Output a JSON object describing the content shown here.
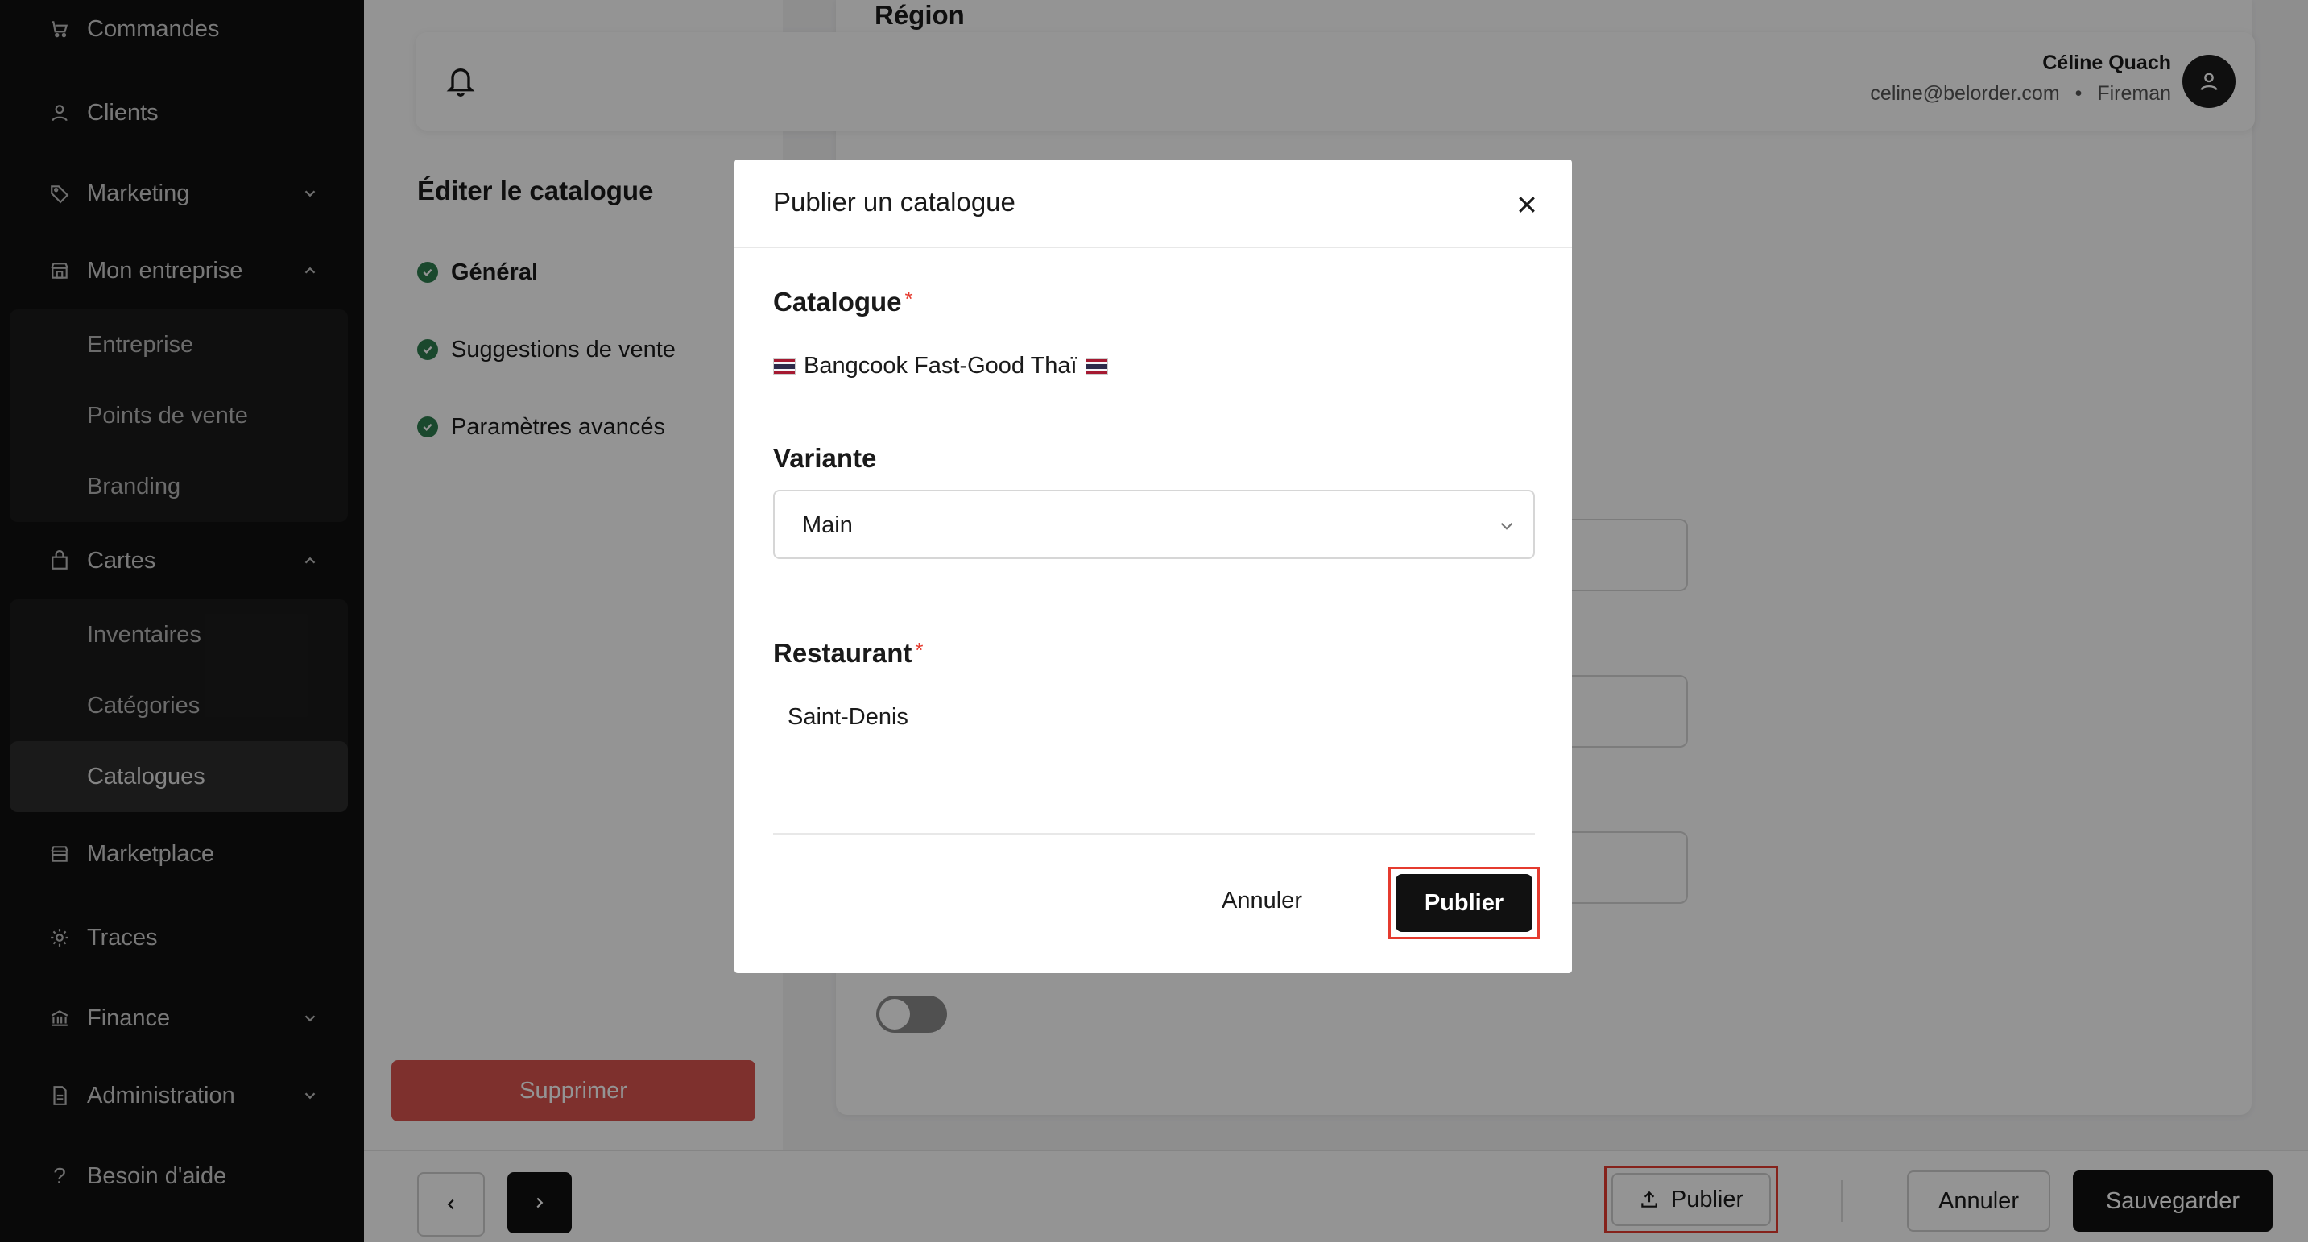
{
  "sidebar": {
    "items": [
      {
        "label": "Commandes",
        "icon": "cart-icon"
      },
      {
        "label": "Clients",
        "icon": "user-icon"
      },
      {
        "label": "Marketing",
        "icon": "tag-icon"
      },
      {
        "label": "Mon entreprise",
        "icon": "store-icon"
      },
      {
        "label": "Cartes",
        "icon": "bag-icon"
      },
      {
        "label": "Marketplace",
        "icon": "store-icon"
      },
      {
        "label": "Traces",
        "icon": "gear-icon"
      },
      {
        "label": "Finance",
        "icon": "bank-icon"
      },
      {
        "label": "Administration",
        "icon": "document-icon"
      },
      {
        "label": "Besoin d'aide",
        "icon": "help-icon"
      }
    ],
    "entreprise_sub": [
      "Entreprise",
      "Points de vente",
      "Branding"
    ],
    "cartes_sub": [
      "Inventaires",
      "Catégories",
      "Catalogues"
    ],
    "active_item": "Catalogues"
  },
  "header": {
    "user_name": "Céline Quach",
    "user_email": "celine@belorder.com",
    "user_separator": "•",
    "user_role": "Fireman"
  },
  "page": {
    "section_title": "Région",
    "edit_title": "Éditer le catalogue",
    "steps": [
      "Général",
      "Suggestions de vente",
      "Paramètres avancés"
    ],
    "delete_label": "Supprimer"
  },
  "footer": {
    "publish_label": "Publier",
    "cancel_label": "Annuler",
    "save_label": "Sauvegarder"
  },
  "modal": {
    "title": "Publier un catalogue",
    "catalogue_label": "Catalogue",
    "required_mark": "*",
    "catalogue_value": "Bangcook Fast-Good Thaï",
    "variant_label": "Variante",
    "variant_value": "Main",
    "restaurant_label": "Restaurant",
    "restaurant_value": "Saint-Denis",
    "cancel_label": "Annuler",
    "publish_label": "Publier"
  },
  "colors": {
    "sidebar_bg": "#111111",
    "accent_red": "#e53b2f",
    "delete_red": "#d9534f",
    "success_green": "#2e7d4f",
    "primary_dark": "#111111"
  }
}
